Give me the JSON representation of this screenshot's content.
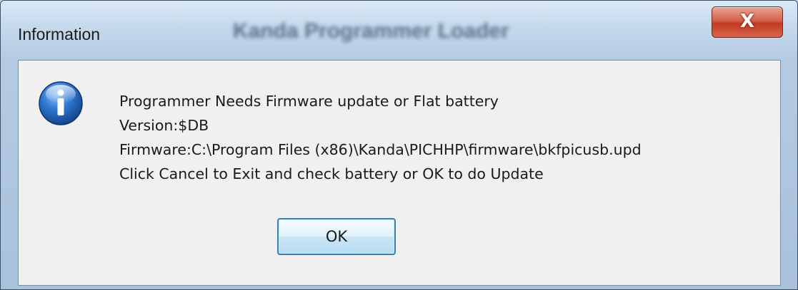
{
  "window": {
    "title": "Information",
    "background_title": "Kanda Programmer Loader",
    "close_label": "X"
  },
  "dialog": {
    "icon": "information-icon",
    "lines": [
      "Programmer Needs Firmware update or Flat battery",
      "Version:$DB",
      "Firmware:C:\\Program Files (x86)\\Kanda\\PICHHP\\firmware\\bkfpicusb.upd",
      "Click Cancel to Exit and check battery or OK to do Update"
    ],
    "ok_label": "OK"
  },
  "colors": {
    "titlebar": "#c6d9ec",
    "client_bg": "#f0f0f0",
    "close_red": "#c23a22",
    "ok_border": "#3c7fb1",
    "icon_blue": "#1f5fb5"
  }
}
